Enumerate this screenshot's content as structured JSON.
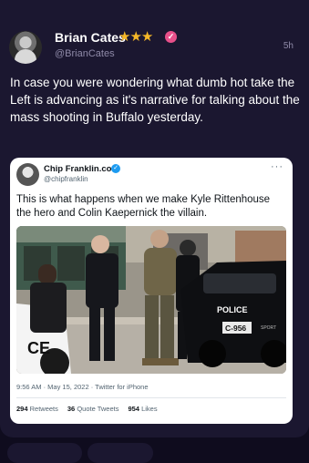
{
  "tweet": {
    "author_name": "Brian Cates",
    "author_badge_stars": "★★★",
    "verified_mark": "✓",
    "author_handle": "@BrianCates",
    "time": "5h",
    "text": "In case you were wondering what dumb hot take the Left is advancing as it's narrative for talking about the mass shooting in Buffalo yesterday."
  },
  "quoted": {
    "author_name": "Chip Franklin.com",
    "verified_mark": "✓",
    "author_handle": "@chipfranklin",
    "more": "···",
    "text": "This is what happens when we make Kyle Rittenhouse the hero and Colin Kaepernick the villain.",
    "photo_labels": {
      "police": "POLICE",
      "unit": "C-956",
      "sport": "SPORT",
      "door_letters": "CE"
    },
    "meta": "9:56 AM · May 15, 2022 · Twitter for iPhone",
    "retweets_count": "294",
    "retweets_label": "Retweets",
    "quote_count": "36",
    "quote_label": "Quote Tweets",
    "likes_count": "954",
    "likes_label": "Likes"
  },
  "colors": {
    "background": "#0f0c1e",
    "card": "#1b1730",
    "stars": "#f5b728",
    "verified_pink": "#e8508a",
    "verified_blue": "#1d9bf0"
  }
}
